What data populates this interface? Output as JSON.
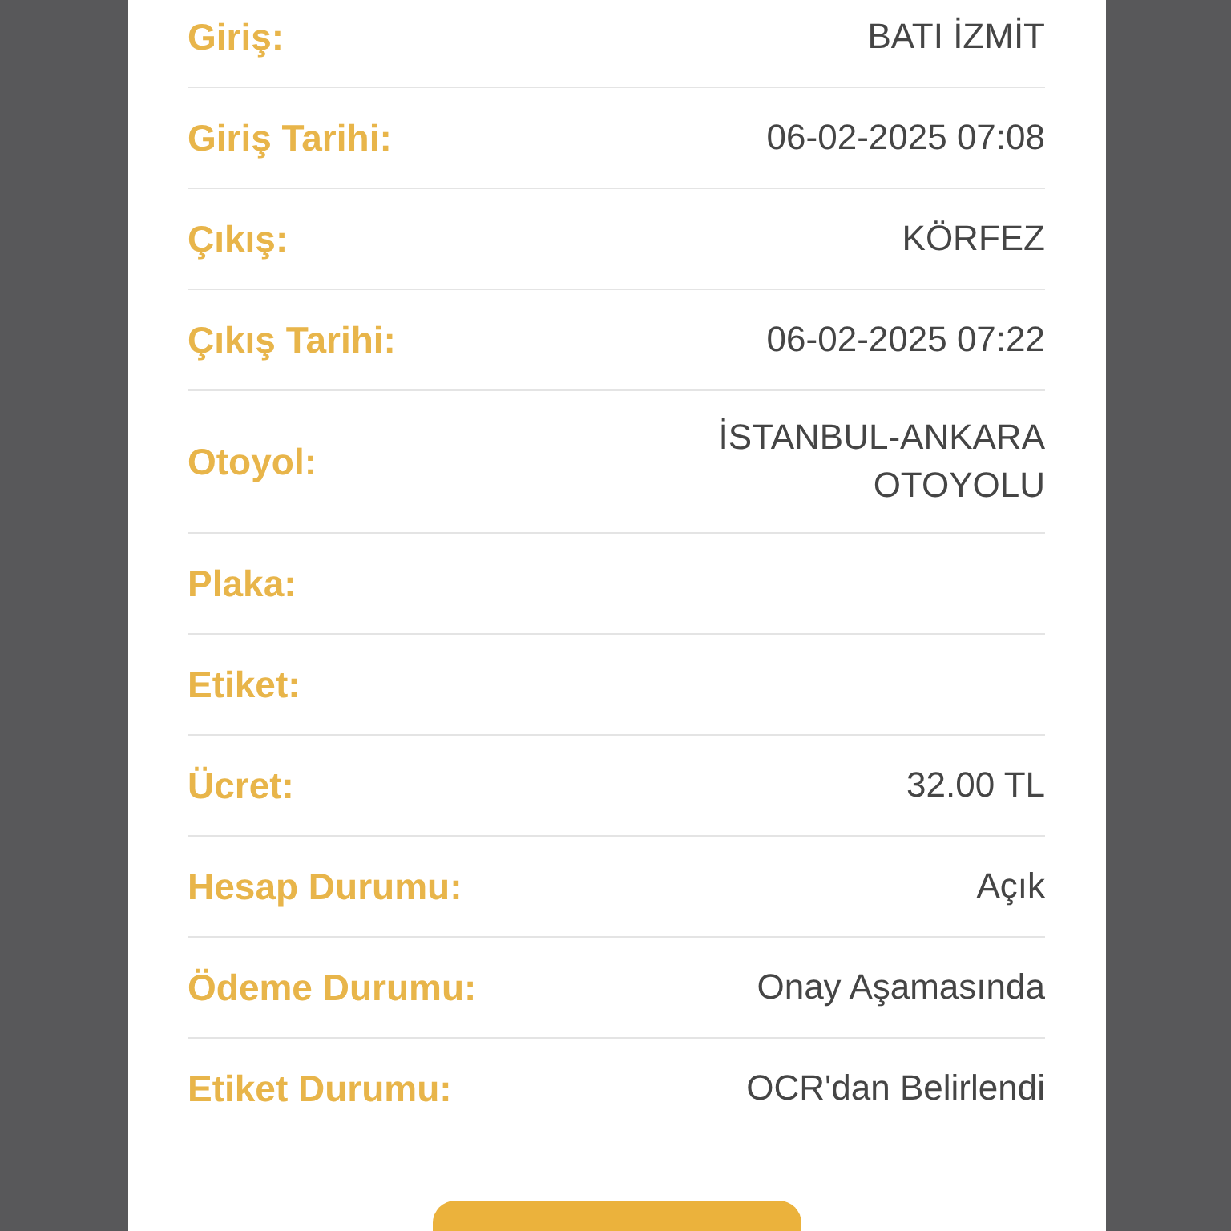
{
  "details": [
    {
      "label": "Giriş:",
      "value": "BATI İZMİT"
    },
    {
      "label": "Giriş Tarihi:",
      "value": "06-02-2025 07:08"
    },
    {
      "label": "Çıkış:",
      "value": "KÖRFEZ"
    },
    {
      "label": "Çıkış Tarihi:",
      "value": "06-02-2025 07:22"
    },
    {
      "label": "Otoyol:",
      "value": "İSTANBUL-ANKARA OTOYOLU"
    },
    {
      "label": "Plaka:"
    },
    {
      "label": "Etiket:"
    },
    {
      "label": "Ücret:",
      "value": "32.00 TL"
    },
    {
      "label": "Hesap Durumu:",
      "value": "Açık"
    },
    {
      "label": "Ödeme Durumu:",
      "value": "Onay Aşamasında"
    },
    {
      "label": "Etiket Durumu:",
      "value": "OCR'dan Belirlendi"
    }
  ]
}
